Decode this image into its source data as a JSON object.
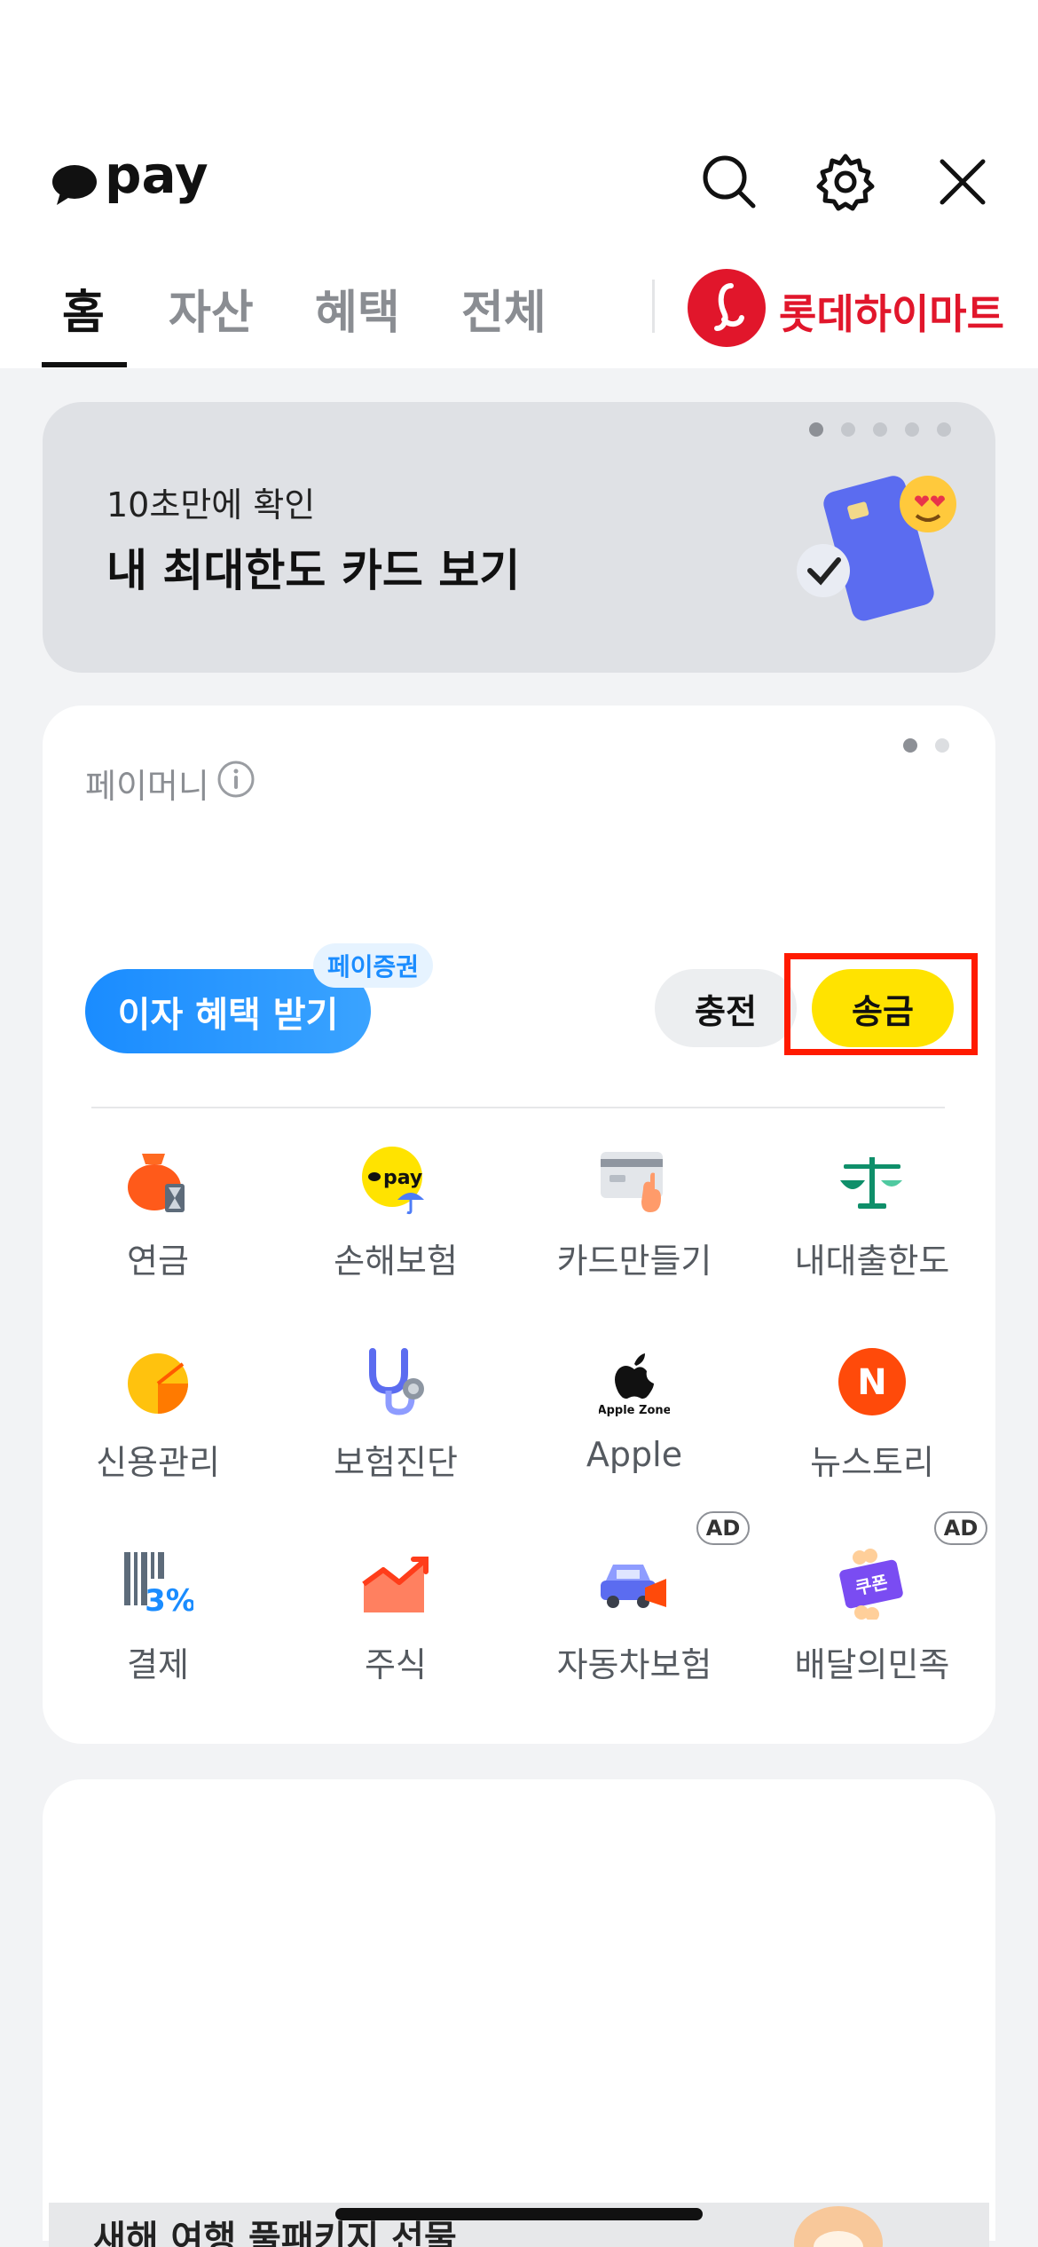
{
  "header": {
    "logo_text": "pay",
    "icons": [
      "search-icon",
      "gear-icon",
      "close-icon"
    ]
  },
  "tabs": [
    {
      "label": "홈",
      "active": true
    },
    {
      "label": "자산",
      "active": false
    },
    {
      "label": "혜택",
      "active": false
    },
    {
      "label": "전체",
      "active": false
    }
  ],
  "partner": {
    "label": "롯데하이마트",
    "color": "#e1162b"
  },
  "banner": {
    "subtitle": "10초만에 확인",
    "title": "내 최대한도 카드 보기",
    "page_count": 5,
    "current_page": 1
  },
  "paymoney": {
    "label": "페이머니",
    "page_count": 2,
    "current_page": 1,
    "interest_button": "이자 혜택 받기",
    "interest_badge": "페이증권",
    "charge_button": "충전",
    "send_button": "송금"
  },
  "menu": [
    {
      "label": "연금",
      "icon": "pension-pouch-icon",
      "ad": false
    },
    {
      "label": "손해보험",
      "icon": "pay-umbrella-icon",
      "ad": false
    },
    {
      "label": "카드만들기",
      "icon": "card-create-icon",
      "ad": false
    },
    {
      "label": "내대출한도",
      "icon": "loan-scale-icon",
      "ad": false
    },
    {
      "label": "신용관리",
      "icon": "credit-gauge-icon",
      "ad": false
    },
    {
      "label": "보험진단",
      "icon": "stethoscope-icon",
      "ad": false
    },
    {
      "label": "Apple",
      "icon": "apple-zone-icon",
      "icon_text": "Apple Zone",
      "ad": false
    },
    {
      "label": "뉴스토리",
      "icon": "newstory-n-icon",
      "icon_text": "N",
      "ad": false
    },
    {
      "label": "결제",
      "icon": "payment-barcode-icon",
      "icon_text": "3%",
      "ad": false
    },
    {
      "label": "주식",
      "icon": "stock-chart-icon",
      "ad": false
    },
    {
      "label": "자동차보험",
      "icon": "car-insurance-icon",
      "ad": true
    },
    {
      "label": "배달의민족",
      "icon": "coupon-icon",
      "icon_text": "쿠폰",
      "ad": true
    }
  ],
  "ad_label": "AD",
  "promo": {
    "text": "새해 여행 풀패키지 선물"
  },
  "colors": {
    "accent_yellow": "#ffe300",
    "accent_blue": "#1a8cff",
    "highlight": "#ff1a00"
  }
}
